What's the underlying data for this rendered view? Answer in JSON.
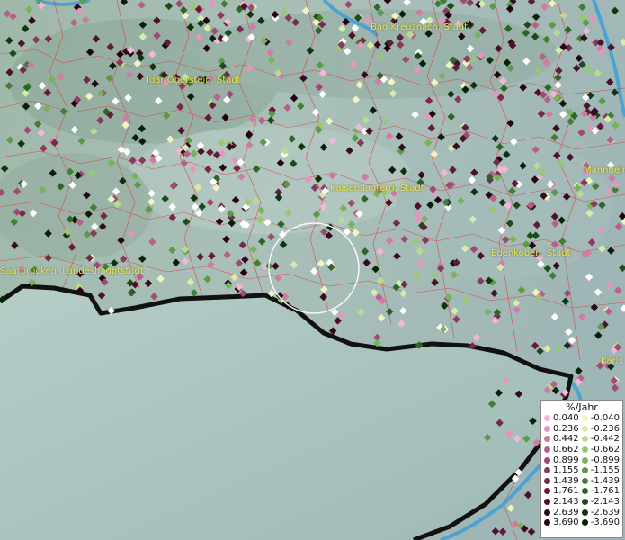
{
  "places": [
    {
      "id": "bad-kreuznach",
      "name": "Bad Kreuznach, Stadt"
    },
    {
      "id": "idar-oberstein",
      "name": "Idar-Oberstein, Stadt"
    },
    {
      "id": "kaiserslautern",
      "name": "Kaiserslautern, Stadt"
    },
    {
      "id": "mannheim",
      "name": "Mannheim"
    },
    {
      "id": "edenkoben",
      "name": "Edenkoben, Stadt"
    },
    {
      "id": "saarbruecken",
      "name": "Saarbrücken, Landeshauptstadt"
    },
    {
      "id": "karlsruhe",
      "name": "Karls"
    }
  ],
  "legend": {
    "title": "%/Jahr",
    "positive": [
      {
        "label": "0.040",
        "color": "#f4b6d8"
      },
      {
        "label": "0.236",
        "color": "#e596c0"
      },
      {
        "label": "0.442",
        "color": "#d27aa6"
      },
      {
        "label": "0.662",
        "color": "#b8608a"
      },
      {
        "label": "0.899",
        "color": "#a04a72"
      },
      {
        "label": "1.155",
        "color": "#8a3a5e"
      },
      {
        "label": "1.439",
        "color": "#752a4b"
      },
      {
        "label": "1.761",
        "color": "#611c3a"
      },
      {
        "label": "2.143",
        "color": "#4d112b"
      },
      {
        "label": "2.639",
        "color": "#380a1d"
      },
      {
        "label": "3.690",
        "color": "#240411"
      }
    ],
    "negative": [
      {
        "label": "-0.040",
        "color": "#f0f5c0"
      },
      {
        "label": "-0.236",
        "color": "#d7eca6"
      },
      {
        "label": "-0.442",
        "color": "#b9dc8a"
      },
      {
        "label": "-0.662",
        "color": "#98c870"
      },
      {
        "label": "-0.899",
        "color": "#78b25a"
      },
      {
        "label": "-1.155",
        "color": "#5c9a45"
      },
      {
        "label": "-1.439",
        "color": "#427f34"
      },
      {
        "label": "-1.761",
        "color": "#2c6526"
      },
      {
        "label": "-2.143",
        "color": "#1a4c1a"
      },
      {
        "label": "-2.639",
        "color": "#0c3510"
      },
      {
        "label": "-3.690",
        "color": "#042008"
      }
    ]
  }
}
